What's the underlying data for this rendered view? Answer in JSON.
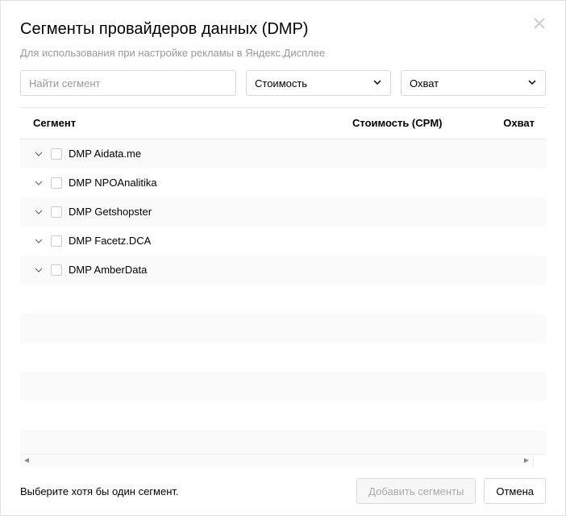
{
  "dialog": {
    "title": "Сегменты провайдеров данных (DMP)",
    "subtitle": "Для использования при настройке рекламы в Яндекс.Дисплее"
  },
  "filters": {
    "search_placeholder": "Найти сегмент",
    "cost_label": "Стоимость",
    "reach_label": "Охват"
  },
  "table": {
    "col_segment": "Сегмент",
    "col_cpm": "Стоимость (CPM)",
    "col_reach": "Охват",
    "rows": [
      {
        "label": "DMP Aidata.me"
      },
      {
        "label": "DMP NPOAnalitika"
      },
      {
        "label": "DMP Getshopster"
      },
      {
        "label": "DMP Facetz.DCA"
      },
      {
        "label": "DMP AmberData"
      }
    ]
  },
  "footer": {
    "message": "Выберите хотя бы один сегмент.",
    "add_label": "Добавить сегменты",
    "cancel_label": "Отмена"
  }
}
